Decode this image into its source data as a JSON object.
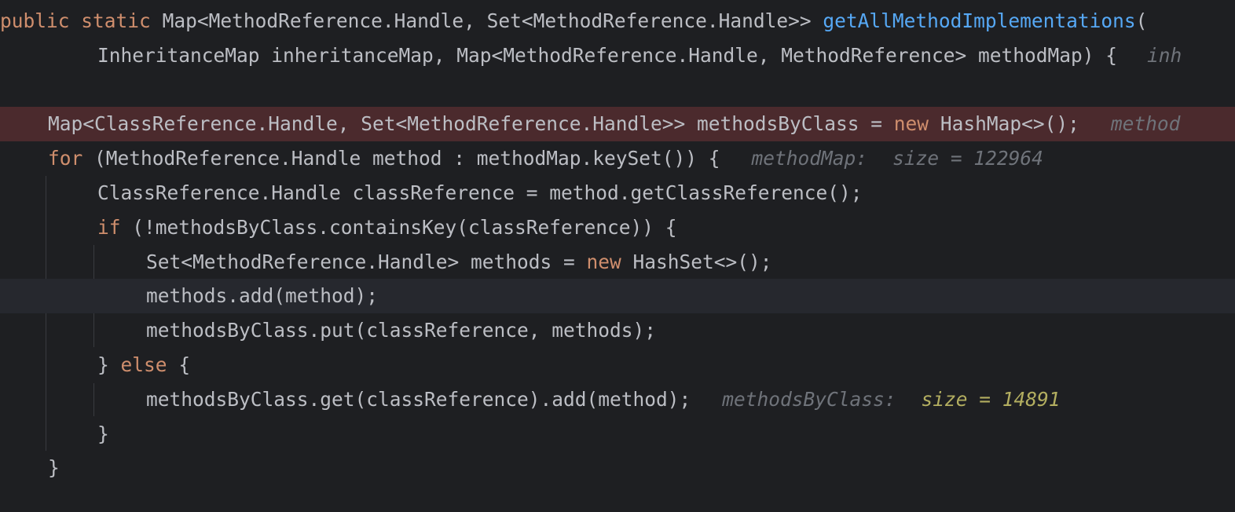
{
  "code": {
    "line1": {
      "kw_public": "public",
      "kw_static": "static",
      "sig_type": "Map<MethodReference.Handle, Set<MethodReference.Handle>>",
      "method_name": "getAllMethodImplementations",
      "open_paren": "("
    },
    "line2": {
      "params": "InheritanceMap inheritanceMap, Map<MethodReference.Handle, MethodReference> methodMap) {",
      "hint": "inh"
    },
    "line4": {
      "decl": "Map<ClassReference.Handle, Set<MethodReference.Handle>> methodsByClass = ",
      "kw_new": "new",
      "init": "HashMap<>();",
      "hint": "method"
    },
    "line5": {
      "kw_for": "for",
      "body": "(MethodReference.Handle method : methodMap.keySet()) {",
      "hint_name": "methodMap:",
      "hint_value": "size = 122964"
    },
    "line6": {
      "text": "ClassReference.Handle classReference = method.getClassReference();"
    },
    "line7": {
      "kw_if": "if",
      "body": "(!methodsByClass.containsKey(classReference)) {"
    },
    "line8": {
      "decl": "Set<MethodReference.Handle> methods = ",
      "kw_new": "new",
      "init": "HashSet<>();"
    },
    "line9": {
      "text": "methods.add(method);"
    },
    "line10": {
      "text": "methodsByClass.put(classReference, methods);"
    },
    "line11": {
      "brace": "}",
      "kw_else": "else",
      "open": "{"
    },
    "line12": {
      "text": "methodsByClass.get(classReference).add(method);",
      "hint_name": "methodsByClass:",
      "hint_value": "size = 14891"
    },
    "line13": {
      "text": "}"
    },
    "line14": {
      "text": "}"
    }
  },
  "colors": {
    "background": "#1e1f22",
    "breakpoint_line": "#4b2a2d",
    "current_line": "#26282e",
    "keyword": "#cf8e6d",
    "method_declaration": "#56a8f5",
    "default_text": "#bcbec4",
    "inlay_hint": "#6f737a",
    "changed_value": "#b3ae60"
  }
}
